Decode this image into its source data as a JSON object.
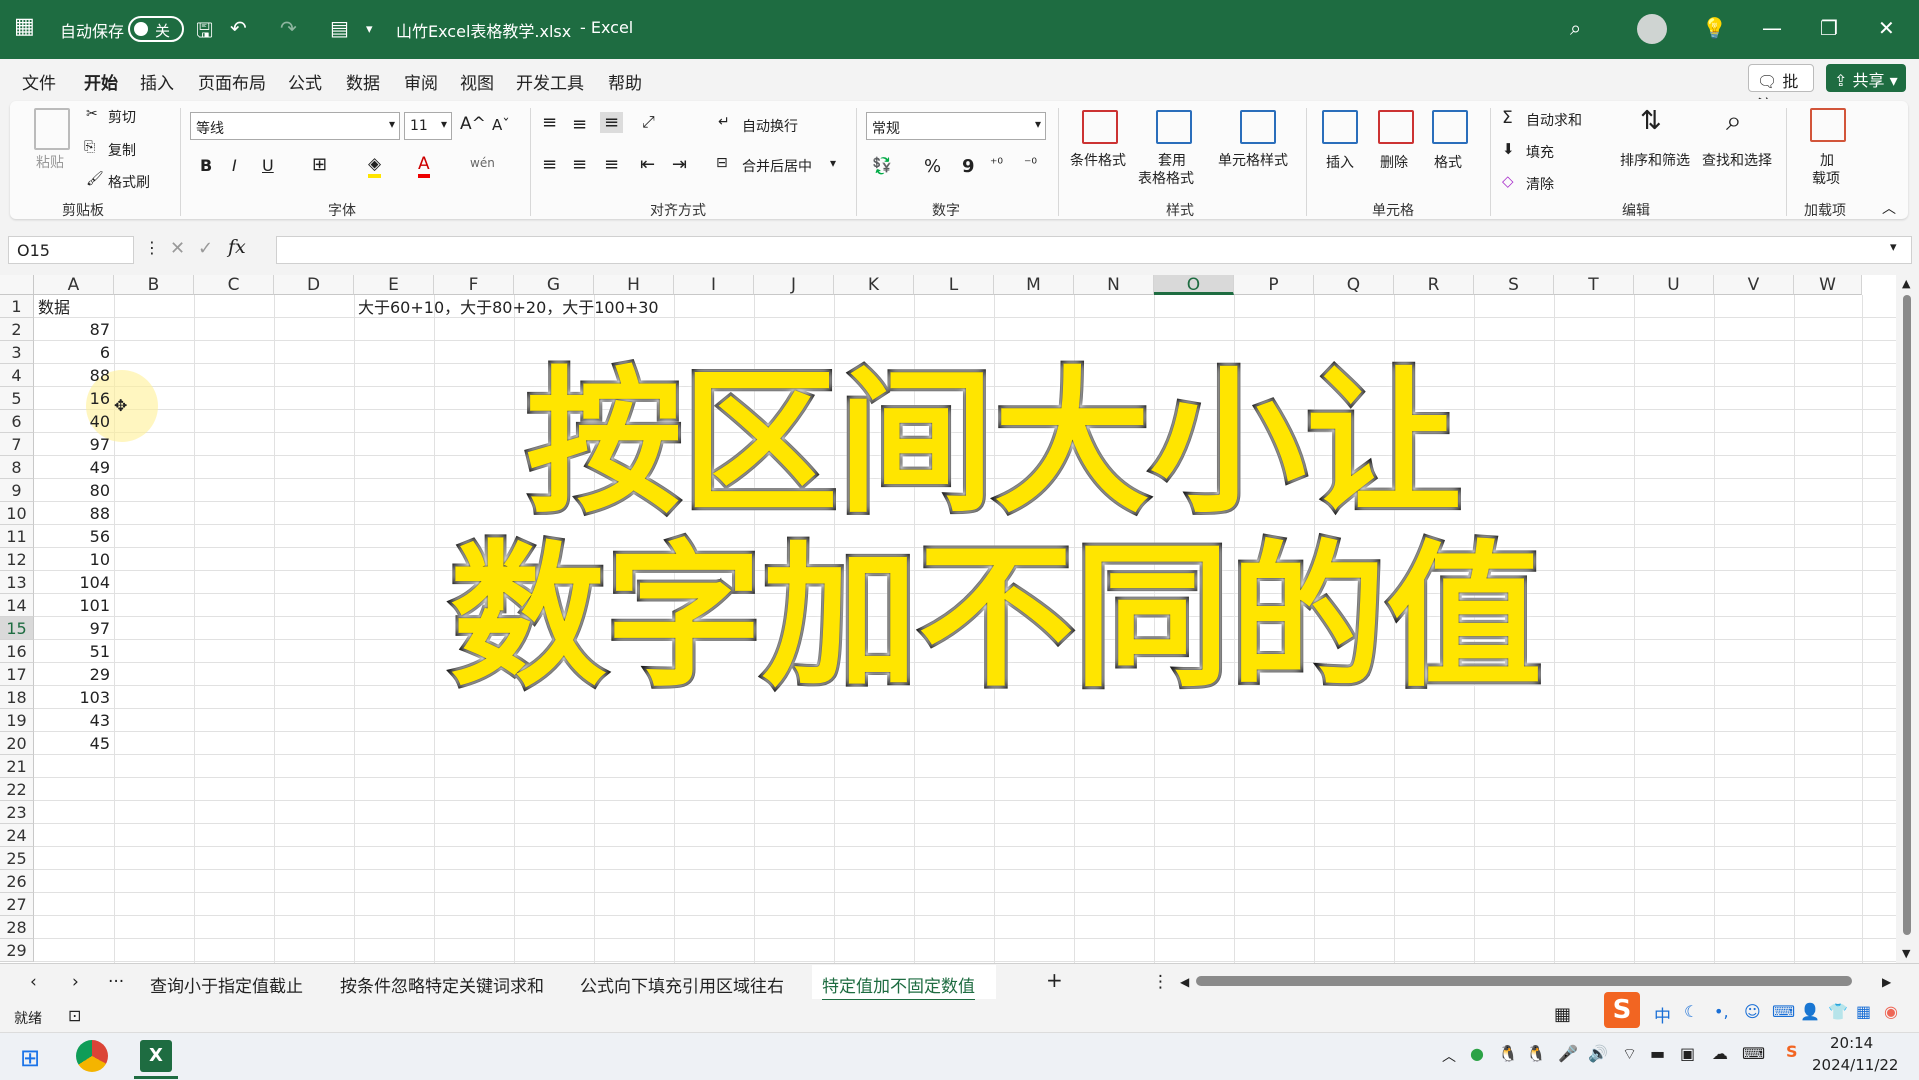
{
  "titlebar": {
    "autosave_label": "自动保存",
    "autosave_state": "关",
    "document_title": "山竹Excel表格教学.xlsx",
    "app_suffix": "-  Excel"
  },
  "menu": {
    "items": [
      "文件",
      "开始",
      "插入",
      "页面布局",
      "公式",
      "数据",
      "审阅",
      "视图",
      "开发工具",
      "帮助"
    ],
    "active": "开始",
    "comment_label": "批注",
    "share_label": "共享"
  },
  "ribbon": {
    "clipboard": {
      "paste": "粘贴",
      "cut": "剪切",
      "copy": "复制",
      "format_painter": "格式刷",
      "group": "剪贴板"
    },
    "font": {
      "family": "等线",
      "size": "11",
      "bold": "B",
      "italic": "I",
      "underline": "U",
      "group": "字体"
    },
    "alignment": {
      "wrap": "自动换行",
      "merge": "合并后居中",
      "group": "对齐方式"
    },
    "number": {
      "format": "常规",
      "percent": "%",
      "comma": "9",
      "group": "数字"
    },
    "styles": {
      "conditional": "条件格式",
      "table_format_1": "套用",
      "table_format_2": "表格格式",
      "cell_styles": "单元格样式",
      "group": "样式"
    },
    "cells": {
      "insert": "插入",
      "delete": "删除",
      "format": "格式",
      "group": "单元格"
    },
    "editing": {
      "autosum": "自动求和",
      "fill": "填充",
      "clear": "清除",
      "sort": "排序和筛选",
      "find": "查找和选择",
      "group": "编辑"
    },
    "addins": {
      "label_1": "加",
      "label_2": "载项",
      "group": "加载项"
    }
  },
  "formula_bar": {
    "name_box": "O15",
    "formula": ""
  },
  "sheet": {
    "columns": [
      "A",
      "B",
      "C",
      "D",
      "E",
      "F",
      "G",
      "H",
      "I",
      "J",
      "K",
      "L",
      "M",
      "N",
      "O",
      "P",
      "Q",
      "R",
      "S",
      "T",
      "U",
      "V",
      "W"
    ],
    "selected_column": "O",
    "selected_row": "15",
    "rows": [
      "1",
      "2",
      "3",
      "4",
      "5",
      "6",
      "7",
      "8",
      "9",
      "10",
      "11",
      "12",
      "13",
      "14",
      "15",
      "16",
      "17",
      "18",
      "19",
      "20",
      "21",
      "22",
      "23",
      "24",
      "25",
      "26",
      "27",
      "28",
      "29"
    ],
    "a1_header": "数据",
    "a_values": [
      "87",
      "6",
      "88",
      "16",
      "40",
      "97",
      "49",
      "80",
      "88",
      "56",
      "10",
      "104",
      "101",
      "97",
      "51",
      "29",
      "103",
      "43",
      "45"
    ],
    "e1_note": "大于60+10，大于80+20，大于100+30"
  },
  "overlay": {
    "line1": "按区间大小让",
    "line2": "数字加不同的值",
    "fill_color": "#ffe500",
    "stroke_color": "#111111"
  },
  "tabs": {
    "items": [
      "查询小于指定值截止",
      "按条件忽略特定关键词求和",
      "公式向下填充引用区域往右",
      "特定值加不固定数值"
    ],
    "active": "特定值加不固定数值",
    "more": "···",
    "add": "+"
  },
  "status": {
    "ready": "就绪"
  },
  "taskbar": {
    "ime": "中",
    "time": "20:14",
    "date": "2024/11/22"
  },
  "colors": {
    "excel_green": "#1e6c41",
    "selection": "#1e6c41"
  }
}
